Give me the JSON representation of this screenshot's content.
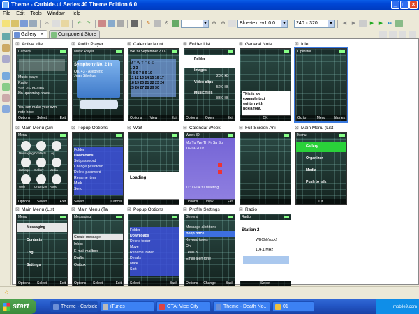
{
  "window": {
    "title": "Theme - Carbide.ui Series 40 Theme Edition 6.0"
  },
  "menu": [
    "File",
    "Edit",
    "Tools",
    "Window",
    "Help"
  ],
  "toolbar": {
    "theme_combo": "Blue-text -v1.0.0",
    "resolution_combo": "240 x 320"
  },
  "tabs": [
    {
      "label": "Gallery",
      "close": "✕"
    },
    {
      "label": "Component Store"
    }
  ],
  "colors": {
    "title_blue": "#0046d5",
    "selection_blue": "#3b7be0",
    "taskbar_blue": "#245edc",
    "start_green": "#3b8a3b"
  },
  "thumbs": [
    {
      "label": "Active Idle",
      "softkeys": [
        "Options",
        "Select",
        "Exit"
      ],
      "status": "Camera",
      "lines": [
        "Music player",
        "Radio",
        "Sun 20-09-2006",
        "No upcoming notes",
        "You can make your own",
        "note here"
      ]
    },
    {
      "label": "Audio Player",
      "softkeys": [
        "",
        "",
        ""
      ],
      "status": "Music Player",
      "lines": [
        "Symphony No. 2 in",
        "Op. 43 - Allegretto",
        "Jean Sibelius"
      ]
    },
    {
      "label": "Calendar Mont",
      "softkeys": [
        "Options",
        "View",
        "Exit"
      ],
      "status": "Wk 39 September 2007",
      "lines": [
        "M T W T F S S",
        "1 2 3",
        "4 5 6 7 8 9 10",
        "11 12 13 14 15 16 17",
        "18 19 20 21 22 23 24",
        "25 26 27 28 29 30"
      ]
    },
    {
      "label": "Folder List",
      "softkeys": [
        "Options",
        "Open",
        "Exit"
      ],
      "status": "",
      "lines": [
        "Folder",
        "27.0 kB",
        "Images",
        "28.0 kB",
        "Video clips",
        "52.0 kB",
        "Music files",
        "83.0 kB"
      ]
    },
    {
      "label": "General Note",
      "softkeys": [
        "",
        "OK",
        ""
      ],
      "status": "",
      "lines": [
        "This is an",
        "example text",
        "written with",
        "nokia font."
      ]
    },
    {
      "label": "Idle",
      "softkeys": [
        "Go to",
        "Menu",
        "Names"
      ],
      "status": "Operator",
      "lines": []
    },
    {
      "label": "Main Menu (Gri",
      "softkeys": [
        "Options",
        "Select",
        "Exit"
      ],
      "status": "Menu",
      "lines": [
        "Messaging",
        "Contacts",
        "Log",
        "Settings",
        "Gallery",
        "Media",
        "Web",
        "Organizer",
        "Apps"
      ]
    },
    {
      "label": "Popup Options",
      "softkeys": [
        "Select",
        "",
        "Cancel"
      ],
      "status": "",
      "lines": [
        "Folder",
        "Downloads",
        "Set password",
        "Change password",
        "Delete password",
        "Rename Item",
        "Mark",
        "Send"
      ]
    },
    {
      "label": "Wait",
      "softkeys": [
        "",
        "",
        ""
      ],
      "status": "",
      "lines": [
        "Loading"
      ]
    },
    {
      "label": "Calendar Week",
      "softkeys": [
        "Options",
        "View",
        "Exit"
      ],
      "status": "Week 39",
      "lines": [
        "Mo Tu We Th Fr Sa Su",
        "18-09-2007",
        "11:00-14:30 Meeting"
      ]
    },
    {
      "label": "Full Screen Ani",
      "softkeys": [
        "",
        "",
        ""
      ],
      "status": "",
      "lines": []
    },
    {
      "label": "Main Menu (List",
      "softkeys": [
        "",
        "OK",
        ""
      ],
      "status": "Menu",
      "lines": [
        "Gallery",
        "Organizer",
        "Media",
        "Push to talk"
      ]
    },
    {
      "label": "Main Menu (List",
      "softkeys": [
        "Options",
        "Select",
        "Exit"
      ],
      "status": "Menu",
      "lines": [
        "Messaging",
        "Contacts",
        "Log",
        "Settings"
      ]
    },
    {
      "label": "Main Menu (Ta",
      "softkeys": [
        "Options",
        "Select",
        "Exit"
      ],
      "status": "Messaging",
      "lines": [
        "Create message",
        "Inbox",
        "E-mail mailbox",
        "Drafts",
        "Outbox"
      ]
    },
    {
      "label": "Popup Options",
      "softkeys": [
        "Select",
        "",
        "Back"
      ],
      "status": "",
      "lines": [
        "Folder",
        "Downloads",
        "Delete folder",
        "Move",
        "Rename folder",
        "Details",
        "Mark",
        "Sort"
      ]
    },
    {
      "label": "Profile Settings",
      "softkeys": [
        "Options",
        "Change",
        "Back"
      ],
      "status": "General",
      "lines": [
        "Message alert tone",
        "Beep once",
        "Keypad tones",
        "On",
        "Level 3",
        "Email alert tone"
      ]
    },
    {
      "label": "Radio",
      "softkeys": [
        "",
        "Select",
        ""
      ],
      "status": "Radio",
      "lines": [
        "Station 2",
        "WBCN (rock)",
        "104.1 MHz"
      ]
    }
  ],
  "taskbar": {
    "start": "start",
    "tasks": [
      "Theme - Carbide....",
      "iTunes",
      "GTA: Vice City",
      "Theme - Death No...",
      "01"
    ],
    "tray": "mobile9.com"
  }
}
